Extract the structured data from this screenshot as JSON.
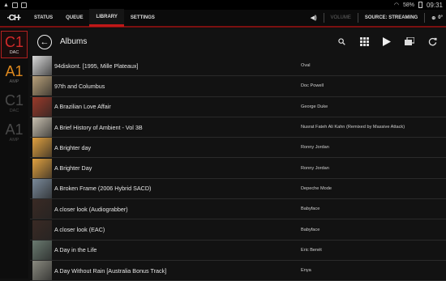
{
  "statusbar": {
    "battery": "58%",
    "time": "09:31"
  },
  "nav": {
    "logo": "·CH·",
    "tabs": [
      {
        "label": "STATUS"
      },
      {
        "label": "QUEUE"
      },
      {
        "label": "LIBRARY"
      },
      {
        "label": "SETTINGS"
      }
    ],
    "volume_label": "VOLUME",
    "source_label": "SOURCE: STREAMING",
    "degree": "0°"
  },
  "sidebar": {
    "zones": [
      {
        "big": "C1",
        "small": "DAC",
        "color": "#d42a2a"
      },
      {
        "big": "A1",
        "small": "AMP",
        "color": "#e08a1e"
      },
      {
        "big": "C1",
        "small": "DAC",
        "color": "#4a4a4a"
      },
      {
        "big": "A1",
        "small": "AMP",
        "color": "#4a4a4a"
      }
    ]
  },
  "header": {
    "title": "Albums"
  },
  "albums": [
    {
      "title": "94diskont. [1995, Mille Plateaux]",
      "artist": "Oval",
      "thumb_color": "#d8d8d8"
    },
    {
      "title": "97th and Columbus",
      "artist": "Doc Powell",
      "thumb_color": "#b8a07a"
    },
    {
      "title": "A Brazilian Love Affair",
      "artist": "George Duke",
      "thumb_color": "#9a3a2a"
    },
    {
      "title": "A Brief History of Ambient - Vol 3B",
      "artist": "Nusrat Fateh Ali Kahn (Remixed by Massive Attack)",
      "thumb_color": "#c8c0b0"
    },
    {
      "title": "A Brighter day",
      "artist": "Ronny Jordan",
      "thumb_color": "#e0a040"
    },
    {
      "title": "A Brighter Day",
      "artist": "Ronny Jordan",
      "thumb_color": "#e0a040"
    },
    {
      "title": "A Broken Frame (2006 Hybrid SACD)",
      "artist": "Depeche Mode",
      "thumb_color": "#7a8a9a"
    },
    {
      "title": "A closer look (Audiograbber)",
      "artist": "Babyface",
      "thumb_color": "#3a2a24"
    },
    {
      "title": "A closer look (EAC)",
      "artist": "Babyface",
      "thumb_color": "#3a2a24"
    },
    {
      "title": "A Day in the Life",
      "artist": "Eric Benét",
      "thumb_color": "#6a7a70"
    },
    {
      "title": "A Day Without Rain [Australia Bonus Track]",
      "artist": "Enya",
      "thumb_color": "#8a8a80"
    }
  ]
}
